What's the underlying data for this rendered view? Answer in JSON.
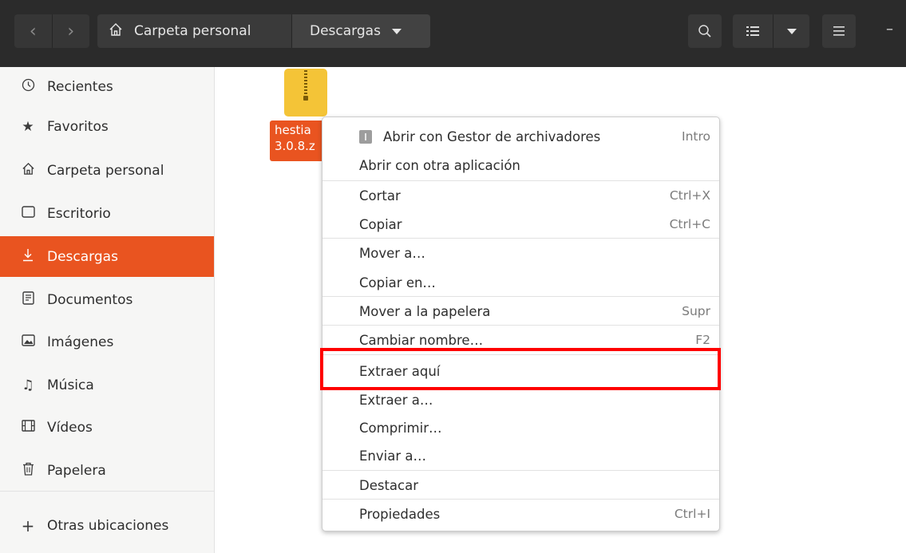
{
  "header": {
    "back_icon": "chevron-left-icon",
    "forward_icon": "chevron-right-icon",
    "path": [
      {
        "label": "Carpeta personal",
        "icon": "home-icon"
      },
      {
        "label": "Descargas"
      }
    ],
    "buttons": [
      "search-icon",
      "list-view-icon",
      "view-options-dropdown",
      "hamburger-menu-icon",
      "minimize-icon"
    ]
  },
  "sidebar": {
    "items": [
      {
        "label": "Recientes",
        "icon": "clock-icon"
      },
      {
        "label": "Favoritos",
        "icon": "star-icon"
      },
      {
        "label": "Carpeta personal",
        "icon": "home-icon"
      },
      {
        "label": "Escritorio",
        "icon": "desktop-icon"
      },
      {
        "label": "Descargas",
        "icon": "download-icon",
        "active": true
      },
      {
        "label": "Documentos",
        "icon": "document-icon"
      },
      {
        "label": "Imágenes",
        "icon": "image-icon"
      },
      {
        "label": "Música",
        "icon": "music-icon"
      },
      {
        "label": "Vídeos",
        "icon": "film-icon"
      },
      {
        "label": "Papelera",
        "icon": "trash-icon"
      },
      {
        "label": "Otras ubicaciones",
        "icon": "plus-icon"
      }
    ]
  },
  "file": {
    "name_line1": "hestia",
    "name_line2": "3.0.8.z",
    "icon": "zip-archive-icon"
  },
  "context_menu": {
    "items": [
      {
        "label": "Abrir con Gestor de archivadores",
        "shortcut": "Intro",
        "icon": "archive-manager-icon"
      },
      {
        "label": "Abrir con otra aplicación",
        "shortcut": ""
      },
      {
        "label": "Cortar",
        "shortcut": "Ctrl+X"
      },
      {
        "label": "Copiar",
        "shortcut": "Ctrl+C"
      },
      {
        "label": "Mover a…",
        "shortcut": ""
      },
      {
        "label": "Copiar en…",
        "shortcut": ""
      },
      {
        "label": "Mover a la papelera",
        "shortcut": "Supr"
      },
      {
        "label": "Cambiar nombre…",
        "shortcut": "F2"
      },
      {
        "label": "Extraer aquí",
        "shortcut": "",
        "highlighted": true
      },
      {
        "label": "Extraer a…",
        "shortcut": ""
      },
      {
        "label": "Comprimir…",
        "shortcut": ""
      },
      {
        "label": "Enviar a…",
        "shortcut": ""
      },
      {
        "label": "Destacar",
        "shortcut": ""
      },
      {
        "label": "Propiedades",
        "shortcut": "Ctrl+I"
      }
    ]
  },
  "colors": {
    "accent": "#e95420",
    "header_bg": "#2b2b2b",
    "highlight_box": "#ff0000"
  }
}
